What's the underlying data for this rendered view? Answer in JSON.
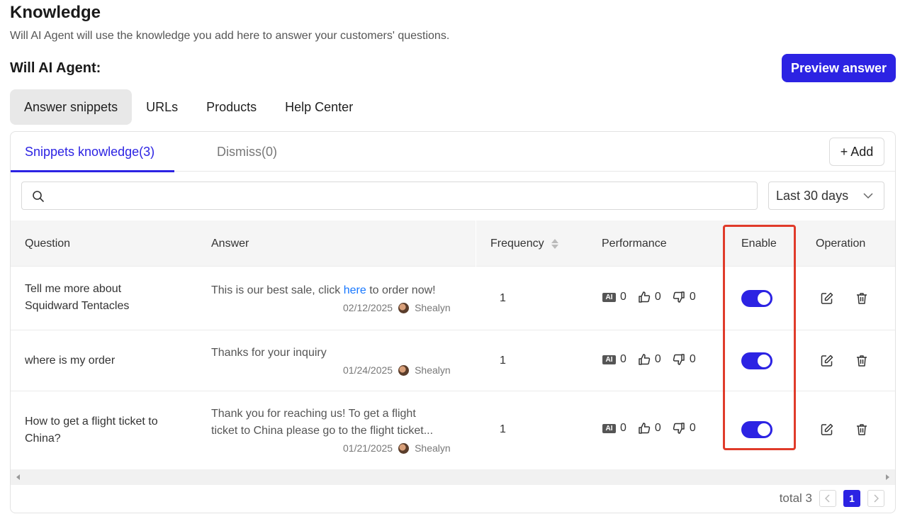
{
  "page": {
    "title": "Knowledge",
    "subtitle": "Will AI Agent will use the knowledge you add here to answer your customers' questions.",
    "agent_label": "Will AI Agent:",
    "preview_button": "Preview answer"
  },
  "top_tabs": [
    {
      "label": "Answer snippets",
      "active": true
    },
    {
      "label": "URLs",
      "active": false
    },
    {
      "label": "Products",
      "active": false
    },
    {
      "label": "Help Center",
      "active": false
    }
  ],
  "sub_tabs": {
    "snippets": "Snippets knowledge(3)",
    "dismiss": "Dismiss(0)",
    "add_button": "+ Add"
  },
  "search": {
    "placeholder": "",
    "value": ""
  },
  "date_filter": {
    "selected": "Last 30 days"
  },
  "table": {
    "headers": {
      "question": "Question",
      "answer": "Answer",
      "frequency": "Frequency",
      "performance": "Performance",
      "enable": "Enable",
      "operation": "Operation"
    },
    "rows": [
      {
        "question_line1": "Tell me more about",
        "question_line2": "Squidward Tentacles",
        "answer_pre": "This is our best sale, click ",
        "answer_link": "here",
        "answer_post": " to order now!",
        "date": "02/12/2025",
        "author": "Shealyn",
        "frequency": "1",
        "ai": "0",
        "likes": "0",
        "dislikes": "0",
        "enabled": true
      },
      {
        "question_line1": "where is my order",
        "answer_line1": "Thanks for your inquiry",
        "date": "01/24/2025",
        "author": "Shealyn",
        "frequency": "1",
        "ai": "0",
        "likes": "0",
        "dislikes": "0",
        "enabled": true
      },
      {
        "question_line1": "How to get a flight ticket to",
        "question_line2": "China?",
        "answer_line1": "Thank you for reaching us! To get a flight",
        "answer_line2": "ticket to China please go to the flight ticket...",
        "date": "01/21/2025",
        "author": "Shealyn",
        "frequency": "1",
        "ai": "0",
        "likes": "0",
        "dislikes": "0",
        "enabled": true
      }
    ]
  },
  "pagination": {
    "total_label": "total 3",
    "current_page": "1"
  },
  "icons": [
    "search-icon",
    "chevron-down-icon",
    "sort-icon",
    "ai-badge-icon",
    "thumbs-up-icon",
    "thumbs-down-icon",
    "edit-icon",
    "trash-icon",
    "chevron-left-icon",
    "chevron-right-icon"
  ],
  "colors": {
    "accent": "#2c23e3",
    "link": "#1677ff",
    "highlight": "#e03b2a"
  }
}
